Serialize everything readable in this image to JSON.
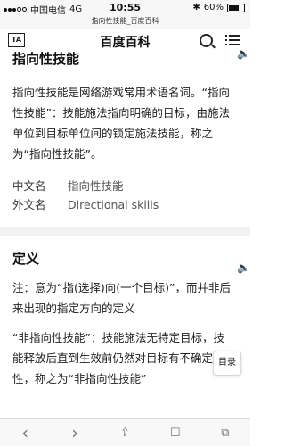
{
  "status": {
    "carrier": "中国电信",
    "network": "4G",
    "time": "10:55",
    "battery": "60%",
    "bluetooth": "bluetooth-icon"
  },
  "url": "指向性技能_百度百科",
  "header": {
    "logo": "TA",
    "title": "百度百科"
  },
  "sections": {
    "intro": {
      "title": "指向性技能",
      "paragraph": "指向性技能是网络游戏常用术语名词。“指向性技能”：技能施法指向明确的目标，由施法单位到目标单位间的锁定施法技能，称之为“指向性技能”。",
      "info": [
        {
          "key": "中文名",
          "value": "指向性技能"
        },
        {
          "key": "外文名",
          "value": "Directional skills"
        }
      ]
    },
    "definition": {
      "title": "定义",
      "note": "注：意为“指(选择)向(一个目标)”，而并非后来出现的指定方向的定义",
      "paragraph": "“非指向性技能”：技能施法无特定目标，技能释放后直到生效前仍然对目标有不确定性，称之为“非指向性技能”"
    }
  },
  "toc_label": "目录",
  "toolbar": {
    "back": "‹",
    "forward": "›",
    "share": "⇪",
    "bookmarks": "☐",
    "tabs": "⧉"
  }
}
